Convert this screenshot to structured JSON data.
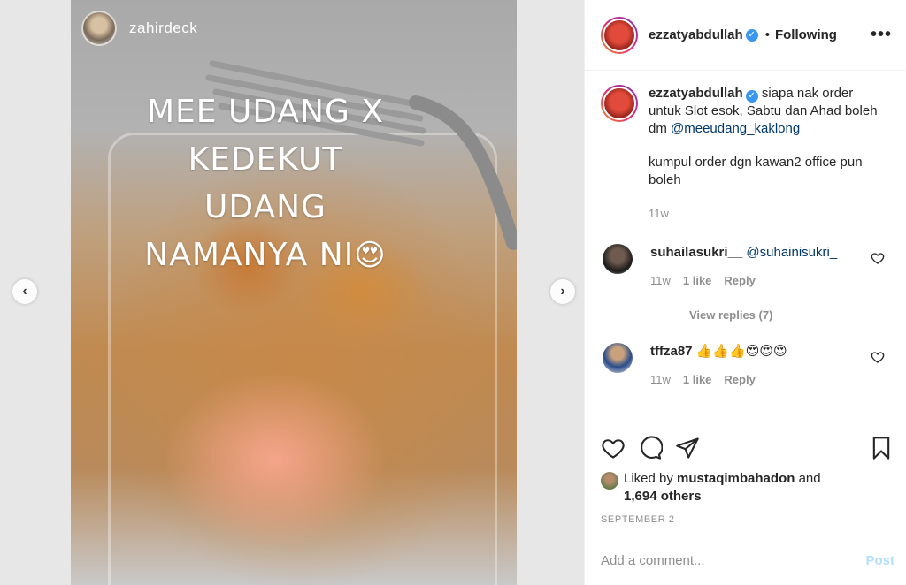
{
  "story": {
    "username": "zahirdeck",
    "caption_line1": "MEE UDANG X",
    "caption_line2": "KEDEKUT UDANG",
    "caption_line3": "NAMANYA NI",
    "caption_emoji": "😍"
  },
  "nav": {
    "prev_icon": "chevron-left-icon",
    "next_icon": "chevron-right-icon",
    "prev_glyph": "‹",
    "next_glyph": "›"
  },
  "post": {
    "author": "ezzatyabdullah",
    "verified_glyph": "✓",
    "dot": "•",
    "follow_status": "Following",
    "more_glyph": "•••",
    "caption_text": "siapa nak order untuk Slot esok, Sabtu dan Ahad boleh dm",
    "caption_mention": "@meeudang_kaklong",
    "caption_text2": "kumpul order dgn kawan2 office pun boleh",
    "caption_time": "11w"
  },
  "comments": [
    {
      "username": "suhailasukri__",
      "text": "",
      "mention": "@suhainisukri_",
      "time": "11w",
      "likes": "1 like",
      "reply": "Reply",
      "view_replies": "View replies (7)"
    },
    {
      "username": "tffza87",
      "text": "👍👍👍😍😍😍",
      "time": "11w",
      "likes": "1 like",
      "reply": "Reply"
    }
  ],
  "likes": {
    "prefix": "Liked by",
    "user": "mustaqimbahadon",
    "conj": "and",
    "others": "1,694 others"
  },
  "date": "SEPTEMBER 2",
  "add_comment": {
    "placeholder": "Add a comment...",
    "post_label": "Post"
  },
  "colors": {
    "link": "#00376b",
    "muted": "#8e8e8e",
    "post_disabled": "#b2dffc",
    "verified": "#3897f0"
  }
}
